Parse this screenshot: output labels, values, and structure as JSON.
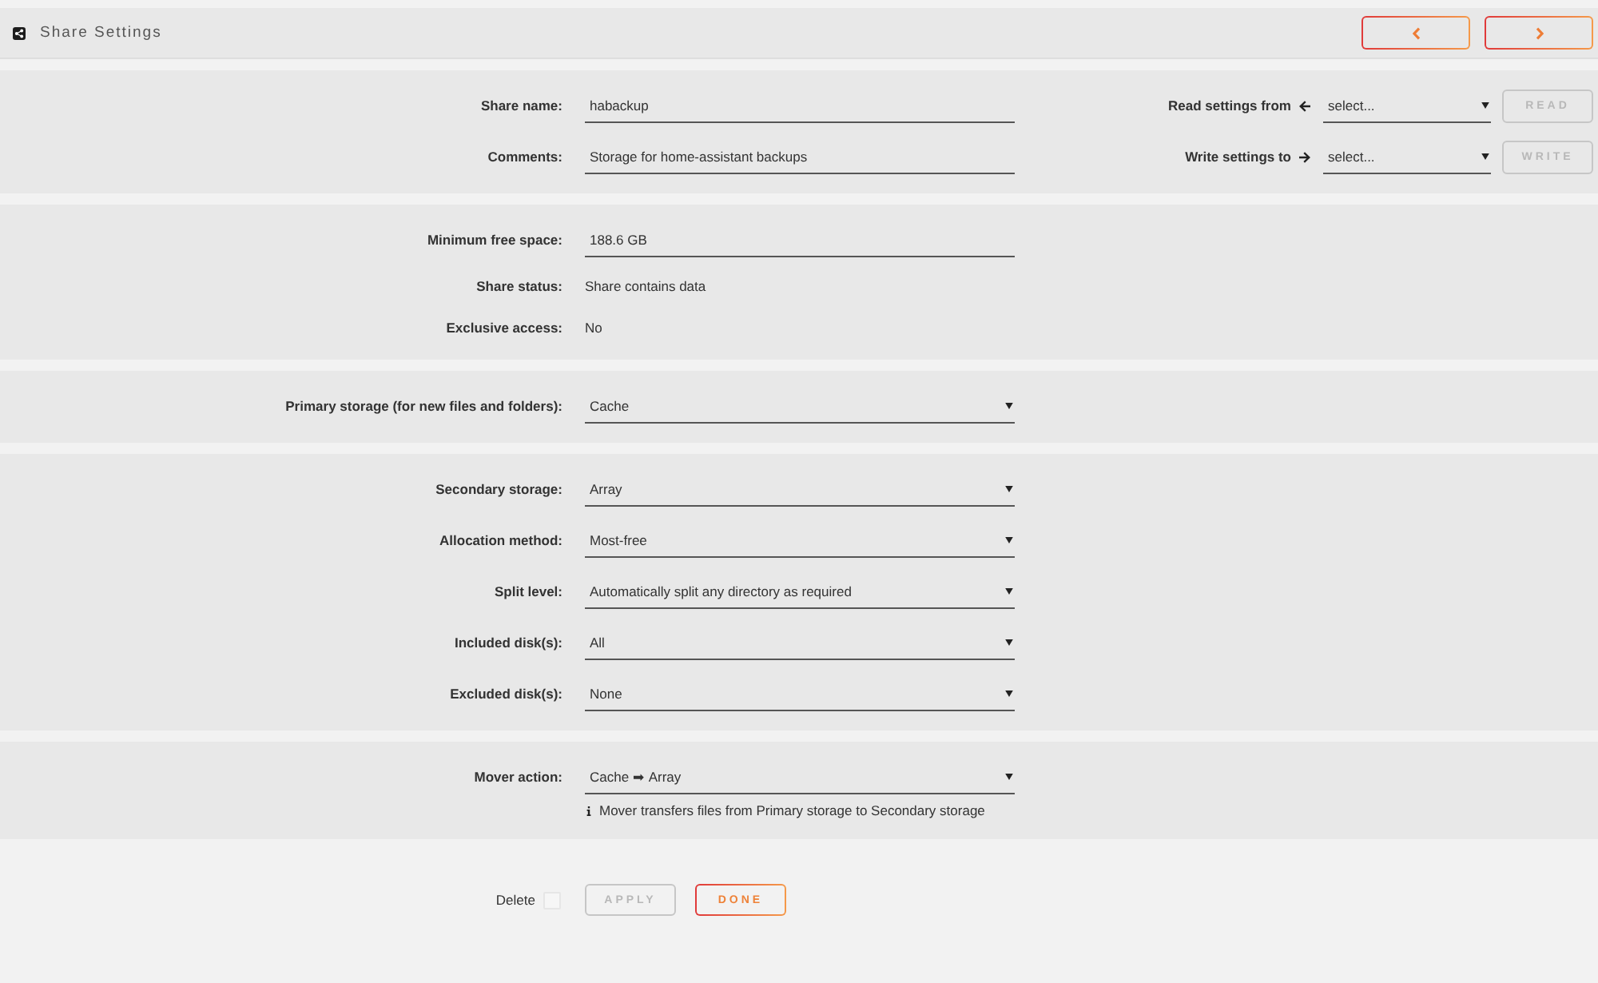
{
  "header": {
    "title": "Share Settings"
  },
  "sections": [
    {
      "fields": [
        {
          "kind": "text",
          "label": "Share name:",
          "value": "habackup"
        },
        {
          "kind": "text",
          "label": "Comments:",
          "value": "Storage for home-assistant backups"
        }
      ],
      "copy_settings": [
        {
          "kind": "read",
          "label": "Read settings from",
          "value": "select...",
          "button": {
            "label": "READ",
            "disabled": true
          }
        },
        {
          "kind": "write",
          "label": "Write settings to",
          "value": "select...",
          "button": {
            "label": "WRITE",
            "disabled": true
          }
        }
      ]
    },
    {
      "fields": [
        {
          "kind": "text",
          "label": "Minimum free space:",
          "value": "188.6 GB"
        },
        {
          "kind": "static",
          "label": "Share status:",
          "value": "Share contains data"
        },
        {
          "kind": "static",
          "label": "Exclusive access:",
          "value": "No"
        }
      ]
    },
    {
      "fields": [
        {
          "kind": "select",
          "label": "Primary storage (for new files and folders):",
          "value": "Cache"
        }
      ]
    },
    {
      "fields": [
        {
          "kind": "select",
          "label": "Secondary storage:",
          "value": "Array"
        },
        {
          "kind": "select",
          "label": "Allocation method:",
          "value": "Most-free"
        },
        {
          "kind": "select",
          "label": "Split level:",
          "value": "Automatically split any directory as required"
        },
        {
          "kind": "select",
          "label": "Included disk(s):",
          "value": "All"
        },
        {
          "kind": "select",
          "label": "Excluded disk(s):",
          "value": "None"
        }
      ]
    },
    {
      "fields": [
        {
          "kind": "select",
          "label": "Mover action:",
          "value": "Cache ➡ Array",
          "note": "Mover transfers files from Primary storage to Secondary storage"
        }
      ]
    }
  ],
  "footer": {
    "delete": {
      "label": "Delete",
      "checked": false
    },
    "buttons": [
      {
        "label": "APPLY",
        "disabled": true
      },
      {
        "label": "DONE",
        "disabled": false
      }
    ]
  }
}
